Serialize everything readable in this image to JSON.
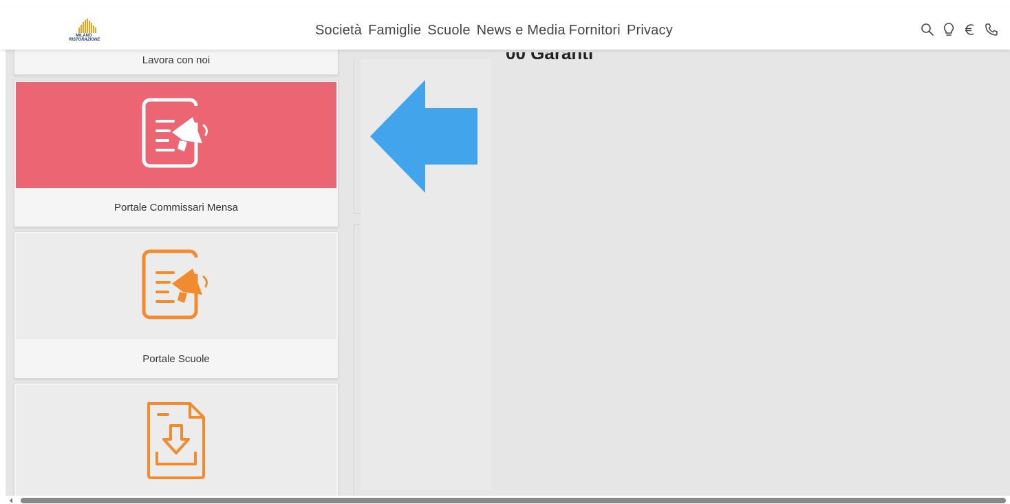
{
  "header": {
    "logo_text": "MILANO RISTORAZIONE",
    "nav": [
      {
        "label": "Società"
      },
      {
        "label": "Famiglie"
      },
      {
        "label": "Scuole"
      },
      {
        "label": "News e Media"
      },
      {
        "label": "Fornitori"
      },
      {
        "label": "Privacy"
      }
    ],
    "icons": [
      "search-icon",
      "lightbulb-icon",
      "euro-icon",
      "phone-icon"
    ]
  },
  "cards": {
    "lavora": {
      "label": "Lavora con noi"
    },
    "commissari": {
      "label": "Portale Commissari Mensa",
      "icon": "document-megaphone-icon",
      "color": "#ec6573"
    },
    "scuole": {
      "label": "Portale Scuole",
      "icon": "document-megaphone-icon",
      "color": "#f28a2e"
    },
    "download": {
      "icon": "document-download-icon",
      "color": "#f28a2e"
    }
  },
  "content": {
    "heading_partial": "00 Garanti"
  },
  "overlay": {
    "arrow_color": "#42a4ea"
  }
}
